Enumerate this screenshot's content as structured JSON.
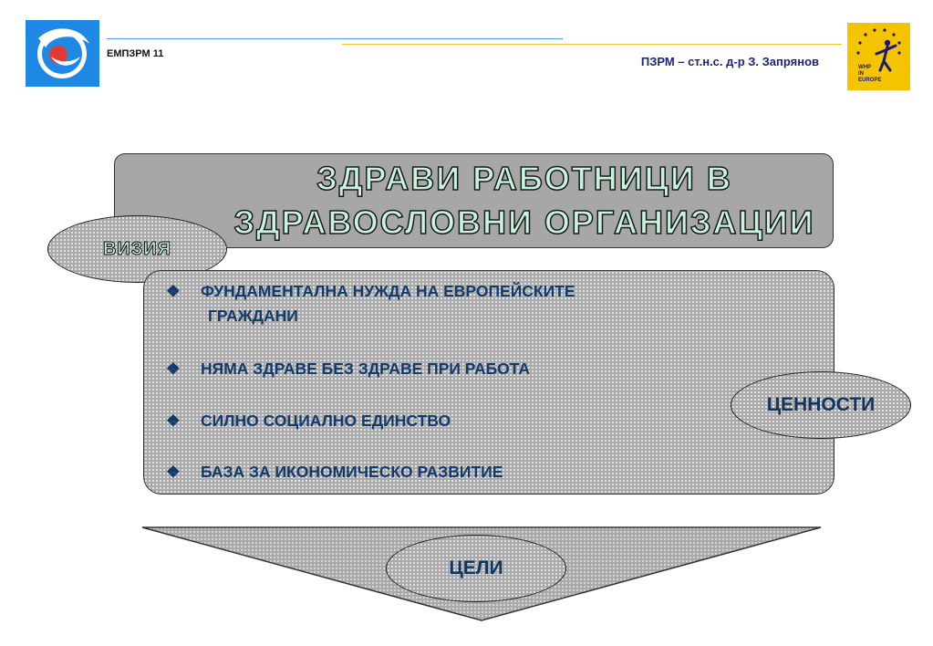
{
  "header": {
    "left_label": "ЕМПЗРМ 11",
    "right_label": "ПЗРМ – ст.н.с. д-р З. Запрянов",
    "right_logo_text": [
      "WHP",
      "IN",
      "EUROPE"
    ]
  },
  "vision": {
    "title_line1": "ЗДРАВИ РАБОТНИЦИ В",
    "title_line2": "ЗДРАВОСЛОВНИ ОРГАНИЗАЦИИ",
    "label": "ВИЗИЯ"
  },
  "values": {
    "bullet_glyph": "❖",
    "items": [
      "ФУНДАМЕНТАЛНА НУЖДА НА ЕВРОПЕЙСКИТЕ",
      "ГРАЖДАНИ",
      "НЯМА ЗДРАВЕ БЕЗ ЗДРАВЕ ПРИ РАБОТА",
      "СИЛНО СОЦИАЛНО ЕДИНСТВО",
      "БАЗА ЗА ИКОНОМИЧЕСКО РАЗВИТИЕ"
    ],
    "label": "ЦЕННОСТИ"
  },
  "goals": {
    "label": "ЦЕЛИ"
  },
  "colors": {
    "accent_text": "#c9f3df",
    "bullet_text": "#123a6b",
    "box_fill": "#a9a9a9",
    "logo_blue": "#1e88e5",
    "logo_yellow": "#f5c400"
  }
}
